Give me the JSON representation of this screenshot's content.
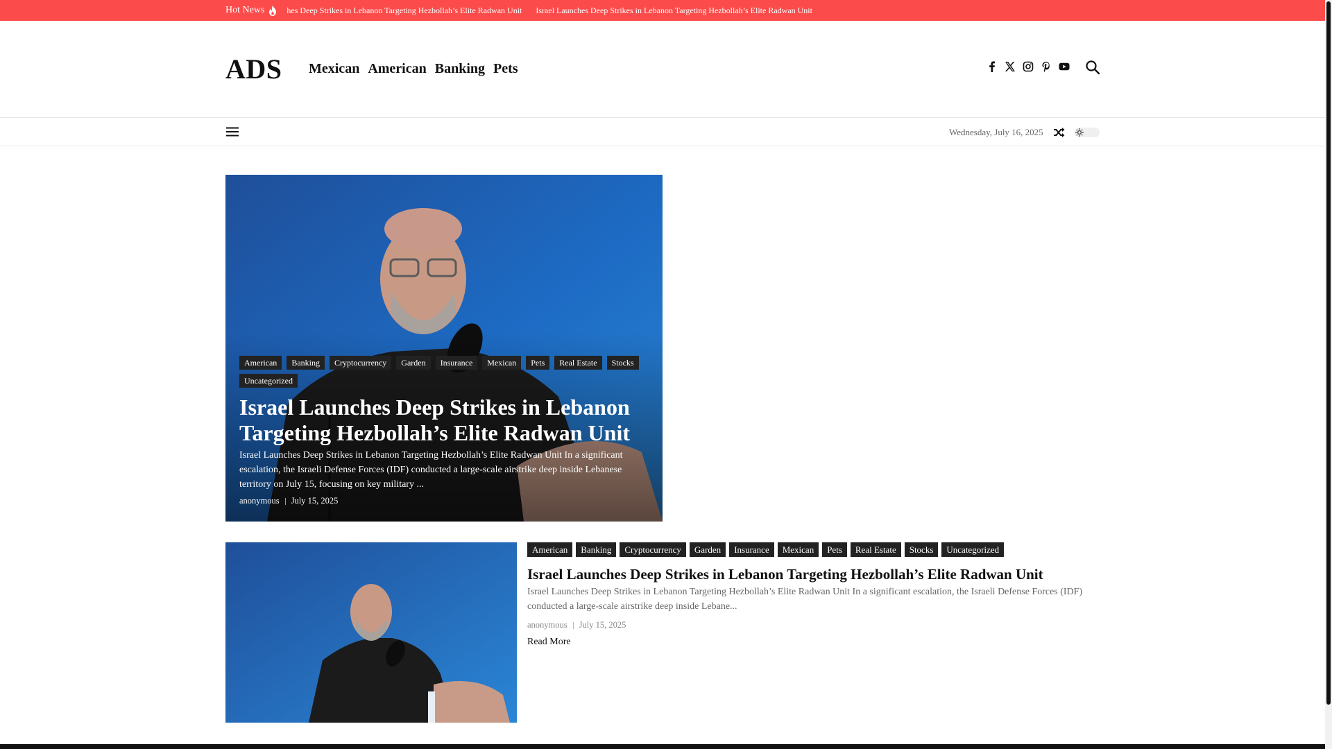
{
  "hot_news": {
    "label": "Hot News",
    "items": [
      "hes Deep Strikes in Lebanon Targeting Hezbollah’s Elite Radwan Unit",
      "Israel Launches Deep Strikes in Lebanon Targeting Hezbollah’s Elite Radwan Unit"
    ],
    "bg_color": "#fc4b4b"
  },
  "header": {
    "logo": "ADS",
    "nav": [
      "Mexican",
      "American",
      "Banking",
      "Pets"
    ],
    "social_icons": [
      "facebook-icon",
      "x-icon",
      "instagram-icon",
      "pinterest-icon",
      "youtube-icon"
    ]
  },
  "subbar": {
    "date": "Wednesday, July 16, 2025"
  },
  "hero": {
    "tags": [
      "American",
      "Banking",
      "Cryptocurrency",
      "Garden",
      "Insurance",
      "Mexican",
      "Pets",
      "Real Estate",
      "Stocks",
      "Uncategorized"
    ],
    "title": "Israel Launches Deep Strikes in Lebanon Targeting Hezbollah’s Elite Radwan Unit",
    "excerpt": "Israel Launches Deep Strikes in Lebanon Targeting Hezbollah’s Elite Radwan Unit In a significant escalation, the Israeli Defense Forces (IDF) conducted a large-scale airstrike deep inside Lebanese territory on July 15, focusing on key military ...",
    "author": "anonymous",
    "date": "July 15, 2025"
  },
  "post": {
    "tags": [
      "American",
      "Banking",
      "Cryptocurrency",
      "Garden",
      "Insurance",
      "Mexican",
      "Pets",
      "Real Estate",
      "Stocks",
      "Uncategorized"
    ],
    "title": "Israel Launches Deep Strikes in Lebanon Targeting Hezbollah’s Elite Radwan Unit",
    "excerpt": "Israel Launches Deep Strikes in Lebanon Targeting Hezbollah’s Elite Radwan Unit In a significant escalation, the Israeli Defense Forces (IDF) conducted a large-scale airstrike deep inside Lebanese territory on July 15, focusing on key military ...",
    "excerpt_short": "Israel Launches Deep Strikes in Lebanon Targeting Hezbollah’s Elite Radwan Unit In a significant escalation, the Israeli Defense Forces (IDF) conducted a large-scale airstrike deep inside Lebane...",
    "author": "anonymous",
    "date": "July 15, 2025",
    "read_more": "Read More"
  }
}
